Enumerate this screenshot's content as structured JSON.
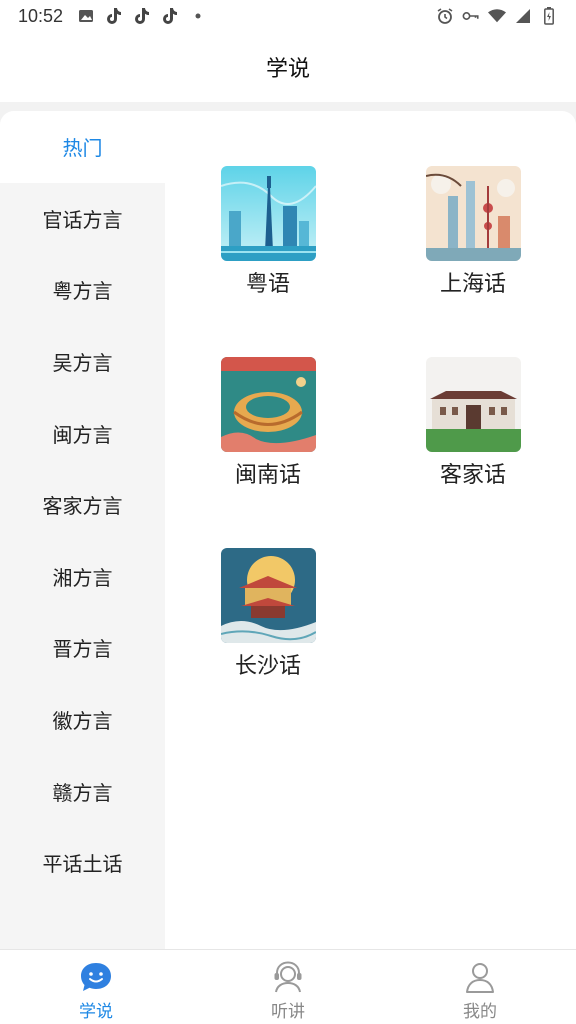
{
  "status_bar": {
    "time": "10:52",
    "left_icons": [
      "image-icon",
      "tiktok-icon",
      "tiktok-icon",
      "tiktok-icon",
      "dot-icon"
    ],
    "right_icons": [
      "alarm-icon",
      "key-icon",
      "wifi-icon",
      "signal-icon",
      "battery-icon"
    ]
  },
  "header": {
    "title": "学说"
  },
  "sidebar": {
    "items": [
      {
        "label": "热门",
        "active": true
      },
      {
        "label": "官话方言"
      },
      {
        "label": "粤方言"
      },
      {
        "label": "吴方言"
      },
      {
        "label": "闽方言"
      },
      {
        "label": "客家方言"
      },
      {
        "label": "湘方言"
      },
      {
        "label": "晋方言"
      },
      {
        "label": "徽方言"
      },
      {
        "label": "赣方言"
      },
      {
        "label": "平话土话"
      }
    ]
  },
  "cards": [
    {
      "label": "粤语",
      "thumb": "guangzhou-tower-illustration"
    },
    {
      "label": "上海话",
      "thumb": "shanghai-pearl-tower-illustration"
    },
    {
      "label": "闽南话",
      "thumb": "tulou-illustration"
    },
    {
      "label": "客家话",
      "thumb": "hakka-house-illustration"
    },
    {
      "label": "长沙话",
      "thumb": "changsha-pavilion-illustration"
    }
  ],
  "tabbar": {
    "tabs": [
      {
        "label": "学说",
        "icon": "chat-smile-icon",
        "active": true
      },
      {
        "label": "听讲",
        "icon": "headset-icon"
      },
      {
        "label": "我的",
        "icon": "person-icon"
      }
    ]
  },
  "colors": {
    "accent": "#1e88e5",
    "sidebar_bg": "#f5f5f5",
    "page_bg": "#f2f2f2"
  }
}
